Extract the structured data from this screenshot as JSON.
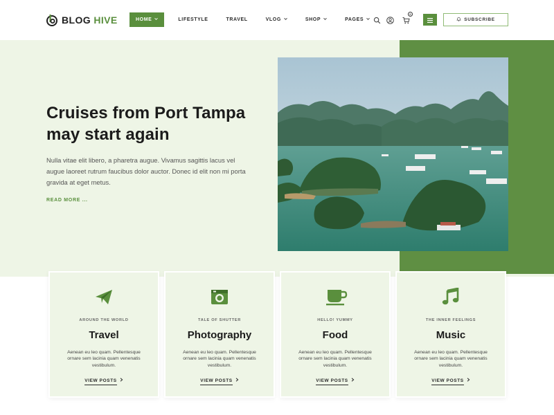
{
  "header": {
    "logo": {
      "main": "BLOG ",
      "accent": "HIVE"
    },
    "nav": [
      {
        "label": "HOME",
        "dropdown": true,
        "active": true
      },
      {
        "label": "LIFESTYLE",
        "dropdown": false
      },
      {
        "label": "TRAVEL",
        "dropdown": false
      },
      {
        "label": "VLOG",
        "dropdown": true
      },
      {
        "label": "SHOP",
        "dropdown": true
      },
      {
        "label": "PAGES",
        "dropdown": true
      }
    ],
    "cart_count": "0",
    "subscribe_label": "SUBSCRIBE"
  },
  "hero": {
    "title": "Cruises from Port Tampa may start again",
    "text": "Nulla vitae elit libero, a pharetra augue. Vivamus sagittis lacus vel augue laoreet rutrum faucibus dolor auctor. Donec id elit non mi porta gravida at eget metus.",
    "read_more": "READ MORE ..."
  },
  "cards": [
    {
      "icon": "paper-plane-icon",
      "kicker": "AROUND THE WORLD",
      "title": "Travel",
      "desc": "Aenean eu leo quam. Pellentesque ornare sem lacinia quam venenatis vestibulum.",
      "link": "VIEW POSTS"
    },
    {
      "icon": "camera-icon",
      "kicker": "TALE OF SHUTTER",
      "title": "Photography",
      "desc": "Aenean eu leo quam. Pellentesque ornare sem lacinia quam venenatis vestibulum.",
      "link": "VIEW POSTS"
    },
    {
      "icon": "coffee-cup-icon",
      "kicker": "HELLO! YUMMY",
      "title": "Food",
      "desc": "Aenean eu leo quam. Pellentesque ornare sem lacinia quam venenatis vestibulum.",
      "link": "VIEW POSTS"
    },
    {
      "icon": "music-note-icon",
      "kicker": "THE INNER FEELINGS",
      "title": "Music",
      "desc": "Aenean eu leo quam. Pellentesque ornare sem lacinia quam venenatis vestibulum.",
      "link": "VIEW POSTS"
    }
  ],
  "colors": {
    "accent": "#5a8f3d",
    "hero_bg": "#eef5e6",
    "hero_green": "#5f8f43"
  }
}
